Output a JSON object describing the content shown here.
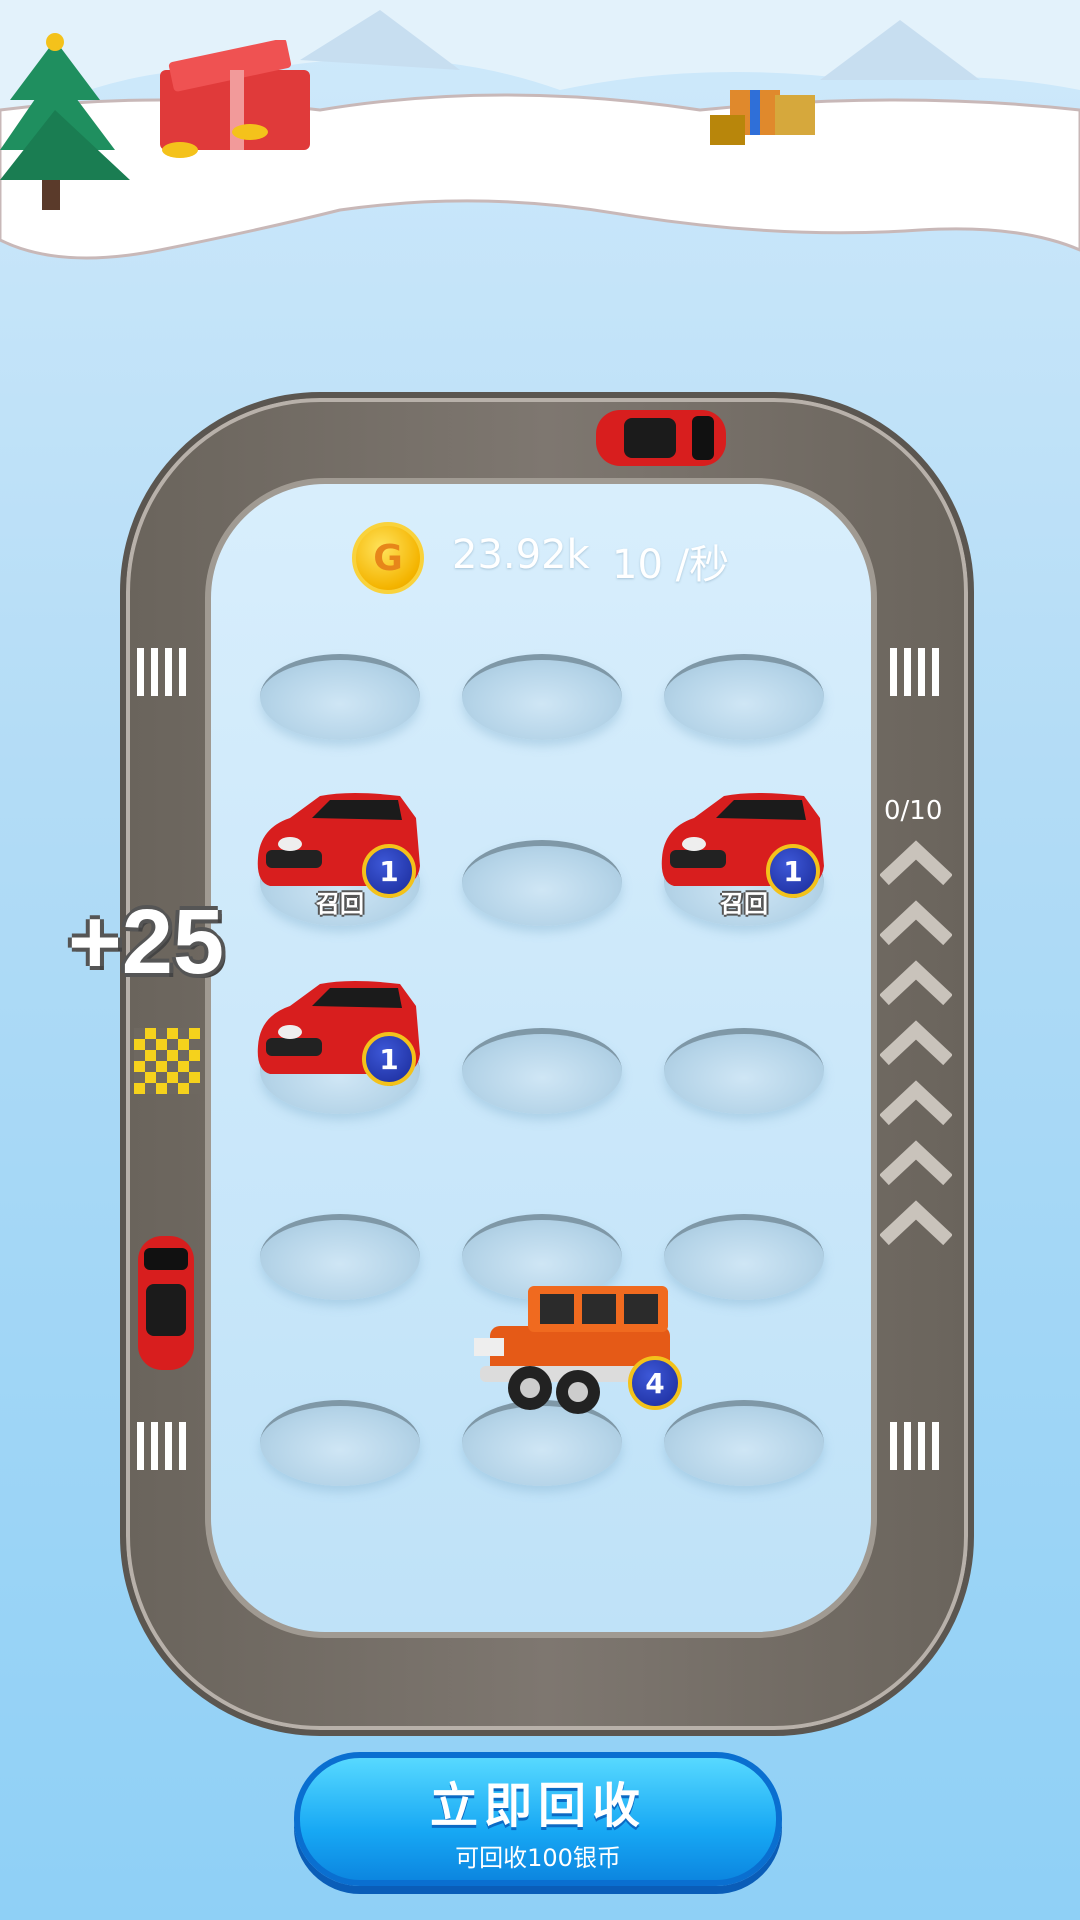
{
  "hud": {
    "coin_icon_letter": "G",
    "coins": "23.92k",
    "rate": "10 /秒"
  },
  "floating_reward": "+25",
  "boost_progress": "0/10",
  "slots": [
    {
      "row": 1,
      "col": 1,
      "car": null
    },
    {
      "row": 1,
      "col": 2,
      "car": null
    },
    {
      "row": 1,
      "col": 3,
      "car": null
    },
    {
      "row": 2,
      "col": 1,
      "car": {
        "type": "red-hatchback",
        "level": "1",
        "action": "召回"
      }
    },
    {
      "row": 2,
      "col": 2,
      "car": null
    },
    {
      "row": 2,
      "col": 3,
      "car": {
        "type": "red-hatchback",
        "level": "1",
        "action": "召回"
      }
    },
    {
      "row": 3,
      "col": 1,
      "car": {
        "type": "red-hatchback",
        "level": "1"
      }
    },
    {
      "row": 3,
      "col": 2,
      "car": null
    },
    {
      "row": 3,
      "col": 3,
      "car": null
    },
    {
      "row": 4,
      "col": 1,
      "car": null
    },
    {
      "row": 4,
      "col": 2,
      "car": null
    },
    {
      "row": 4,
      "col": 3,
      "car": null
    },
    {
      "row": 5,
      "col": 1,
      "car": null
    },
    {
      "row": 5,
      "col": 2,
      "car": null
    },
    {
      "row": 5,
      "col": 3,
      "car": null
    }
  ],
  "dragged_car": {
    "type": "orange-suv",
    "level": "4"
  },
  "recycle_button": {
    "title": "立即回收",
    "subtitle": "可回收100银币"
  },
  "colors": {
    "track": "#736d66",
    "button": "#17a8f4",
    "badge": "#1f35b0",
    "car_red": "#d81e1e"
  }
}
